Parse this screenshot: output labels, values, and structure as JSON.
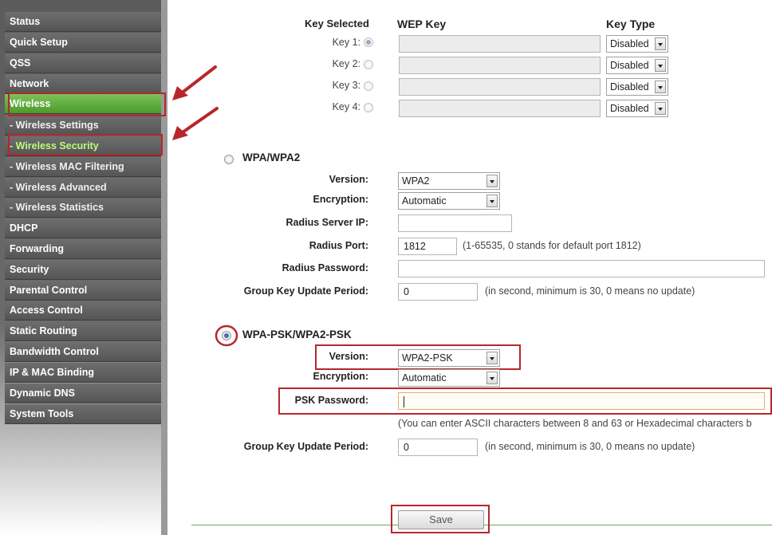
{
  "sidebar": {
    "items": [
      {
        "label": "Status"
      },
      {
        "label": "Quick Setup"
      },
      {
        "label": "QSS"
      },
      {
        "label": "Network"
      },
      {
        "label": "Wireless"
      },
      {
        "label": "- Wireless Settings"
      },
      {
        "label": "- Wireless Security"
      },
      {
        "label": "- Wireless MAC Filtering"
      },
      {
        "label": "- Wireless Advanced"
      },
      {
        "label": "- Wireless Statistics"
      },
      {
        "label": "DHCP"
      },
      {
        "label": "Forwarding"
      },
      {
        "label": "Security"
      },
      {
        "label": "Parental Control"
      },
      {
        "label": "Access Control"
      },
      {
        "label": "Static Routing"
      },
      {
        "label": "Bandwidth Control"
      },
      {
        "label": "IP & MAC Binding"
      },
      {
        "label": "Dynamic DNS"
      },
      {
        "label": "System Tools"
      }
    ]
  },
  "wep": {
    "col_key_selected": "Key Selected",
    "col_wep_key": "WEP Key",
    "col_key_type": "Key Type",
    "keys": [
      {
        "label": "Key 1:",
        "type": "Disabled"
      },
      {
        "label": "Key 2:",
        "type": "Disabled"
      },
      {
        "label": "Key 3:",
        "type": "Disabled"
      },
      {
        "label": "Key 4:",
        "type": "Disabled"
      }
    ]
  },
  "wpa": {
    "title": "WPA/WPA2",
    "version_label": "Version:",
    "version_value": "WPA2",
    "encryption_label": "Encryption:",
    "encryption_value": "Automatic",
    "radius_ip_label": "Radius Server IP:",
    "radius_ip_value": "",
    "radius_port_label": "Radius Port:",
    "radius_port_value": "1812",
    "radius_port_note": "(1-65535, 0 stands for default port 1812)",
    "radius_pw_label": "Radius Password:",
    "radius_pw_value": "",
    "gkup_label": "Group Key Update Period:",
    "gkup_value": "0",
    "gkup_note": "(in second, minimum is 30, 0 means no update)"
  },
  "psk": {
    "title": "WPA-PSK/WPA2-PSK",
    "version_label": "Version:",
    "version_value": "WPA2-PSK",
    "encryption_label": "Encryption:",
    "encryption_value": "Automatic",
    "password_label": "PSK Password:",
    "password_value": "",
    "password_note": "(You can enter ASCII characters between 8 and 63 or Hexadecimal characters b",
    "gkup_label": "Group Key Update Period:",
    "gkup_value": "0",
    "gkup_note": "(in second, minimum is 30, 0 means no update)"
  },
  "save_label": "Save",
  "colors": {
    "highlight": "#b8262b",
    "active_green": "#5aa83a",
    "sidebar": "#5b5b5b"
  }
}
